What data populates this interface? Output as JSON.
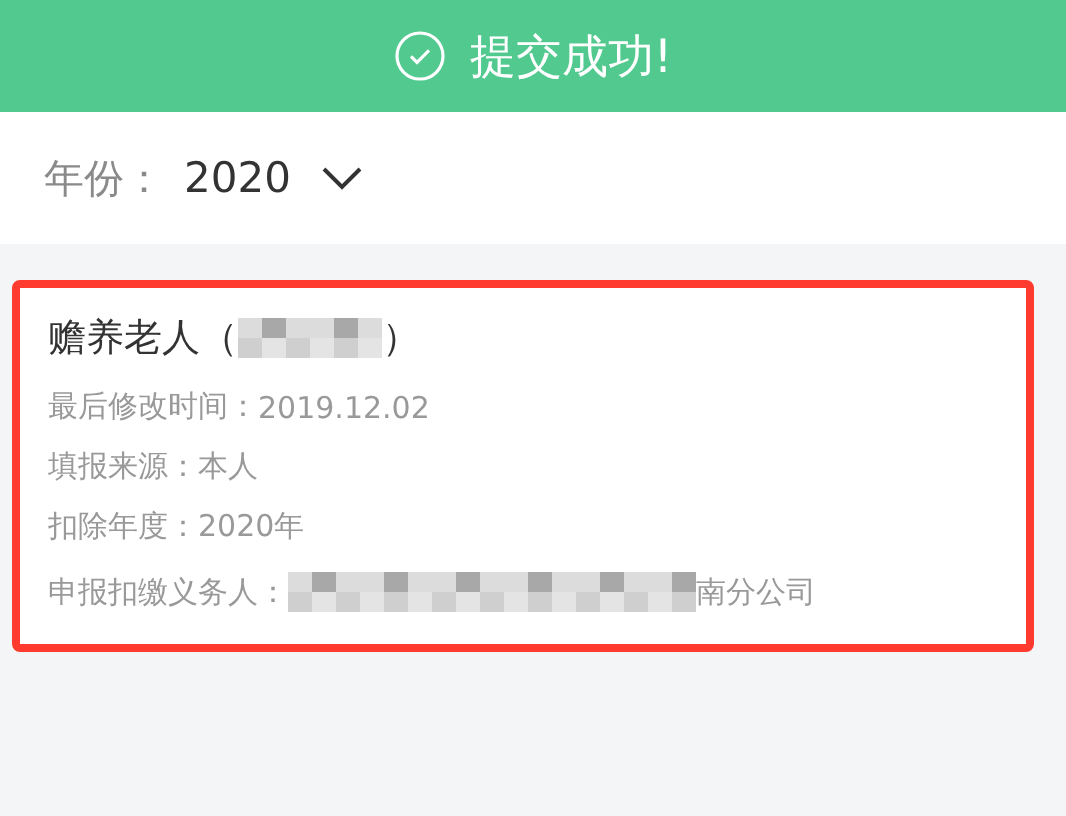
{
  "header": {
    "title": "提交成功!"
  },
  "year_selector": {
    "label": "年份：",
    "value": "2020"
  },
  "record": {
    "title_start": "赡养老人（",
    "title_redacted": true,
    "title_end": "）",
    "highlighted": true,
    "rows": [
      {
        "label": "最后修改时间：",
        "value": "2019.12.02",
        "redacted": false
      },
      {
        "label": "填报来源：",
        "value": "本人",
        "redacted": false
      },
      {
        "label": "扣除年度：",
        "value": "2020年",
        "redacted": false
      },
      {
        "label": "申报扣缴义务人：",
        "value": "南分公司",
        "redacted": true
      }
    ]
  }
}
